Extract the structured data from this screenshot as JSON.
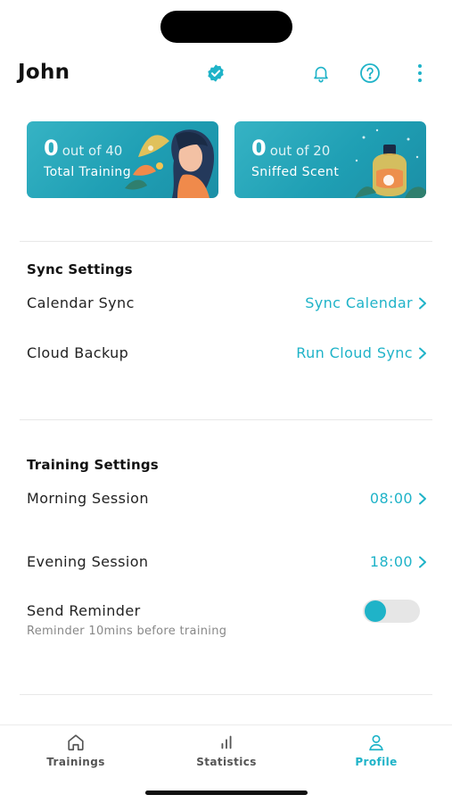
{
  "header": {
    "user_name": "John",
    "icons": {
      "verified": "verified-badge-icon",
      "notifications": "bell-icon",
      "help": "question-circle-icon",
      "more": "more-vertical-icon"
    }
  },
  "stats": [
    {
      "count": "0",
      "total": "out of 40",
      "label": "Total Training"
    },
    {
      "count": "0",
      "total": "out of 20",
      "label": "Sniffed Scent"
    }
  ],
  "sync_settings": {
    "title": "Sync Settings",
    "rows": [
      {
        "label": "Calendar Sync",
        "action": "Sync Calendar"
      },
      {
        "label": "Cloud Backup",
        "action": "Run Cloud Sync"
      }
    ]
  },
  "training_settings": {
    "title": "Training Settings",
    "morning": {
      "label": "Morning Session",
      "value": "08:00"
    },
    "evening": {
      "label": "Evening Session",
      "value": "18:00"
    },
    "reminder": {
      "label": "Send Reminder",
      "subtext": "Reminder 10mins before training",
      "enabled": true
    }
  },
  "tabs": [
    {
      "label": "Trainings",
      "icon": "home-icon",
      "active": false
    },
    {
      "label": "Statistics",
      "icon": "bar-chart-icon",
      "active": false
    },
    {
      "label": "Profile",
      "icon": "user-icon",
      "active": true
    }
  ],
  "colors": {
    "accent": "#1fb3c8",
    "card_gradient_start": "#36b3c4",
    "card_gradient_end": "#1b8fa6",
    "text": "#1d1d1f",
    "muted": "#888888"
  }
}
